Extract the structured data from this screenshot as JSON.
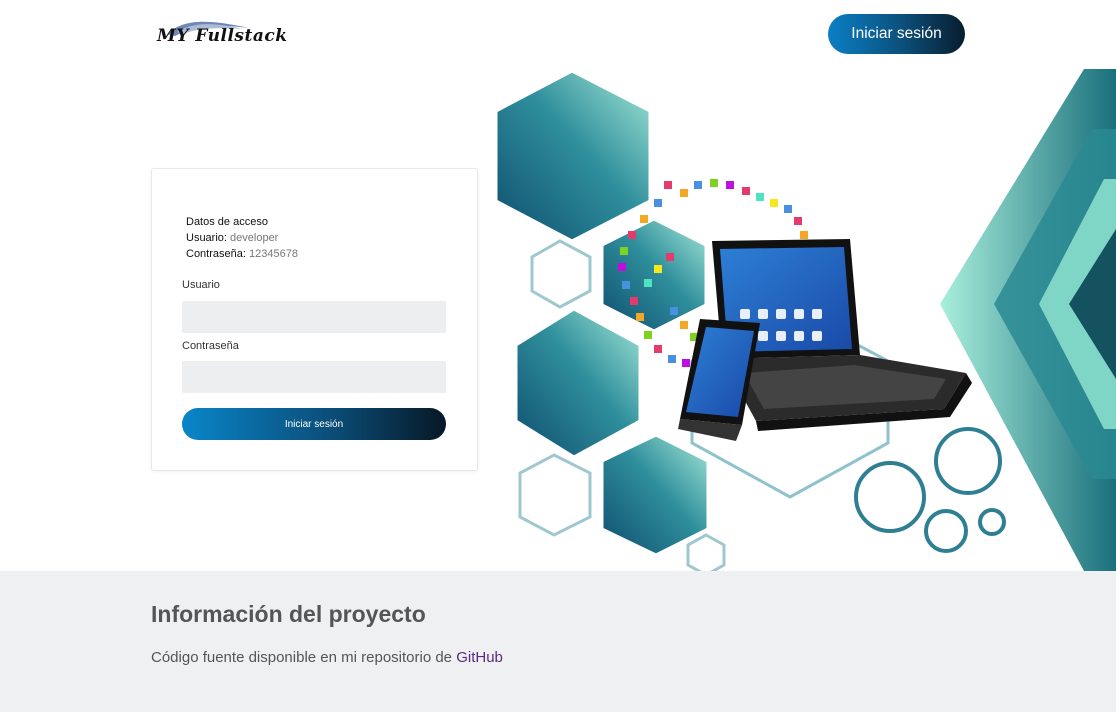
{
  "navbar": {
    "logo_text": "MY Fullstack",
    "login_button": "Iniciar sesión"
  },
  "login": {
    "access_title": "Datos de acceso",
    "user_label": "Usuario:",
    "user_value": "developer",
    "password_label": "Contraseña:",
    "password_value": "12345678",
    "field_user_label": "Usuario",
    "field_user_value": "",
    "field_password_label": "Contraseña",
    "field_password_value": "",
    "submit_label": "Iniciar sesión"
  },
  "footer": {
    "title": "Información del proyecto",
    "text": "Código fuente disponible en mi repositorio de",
    "link": "GitHub"
  },
  "colors": {
    "button_gradient_start": "#0a7fc4",
    "button_gradient_end": "#081d2e",
    "footer_bg": "#eef0f1",
    "link": "#5a2a82",
    "input_bg": "#eceeef"
  }
}
